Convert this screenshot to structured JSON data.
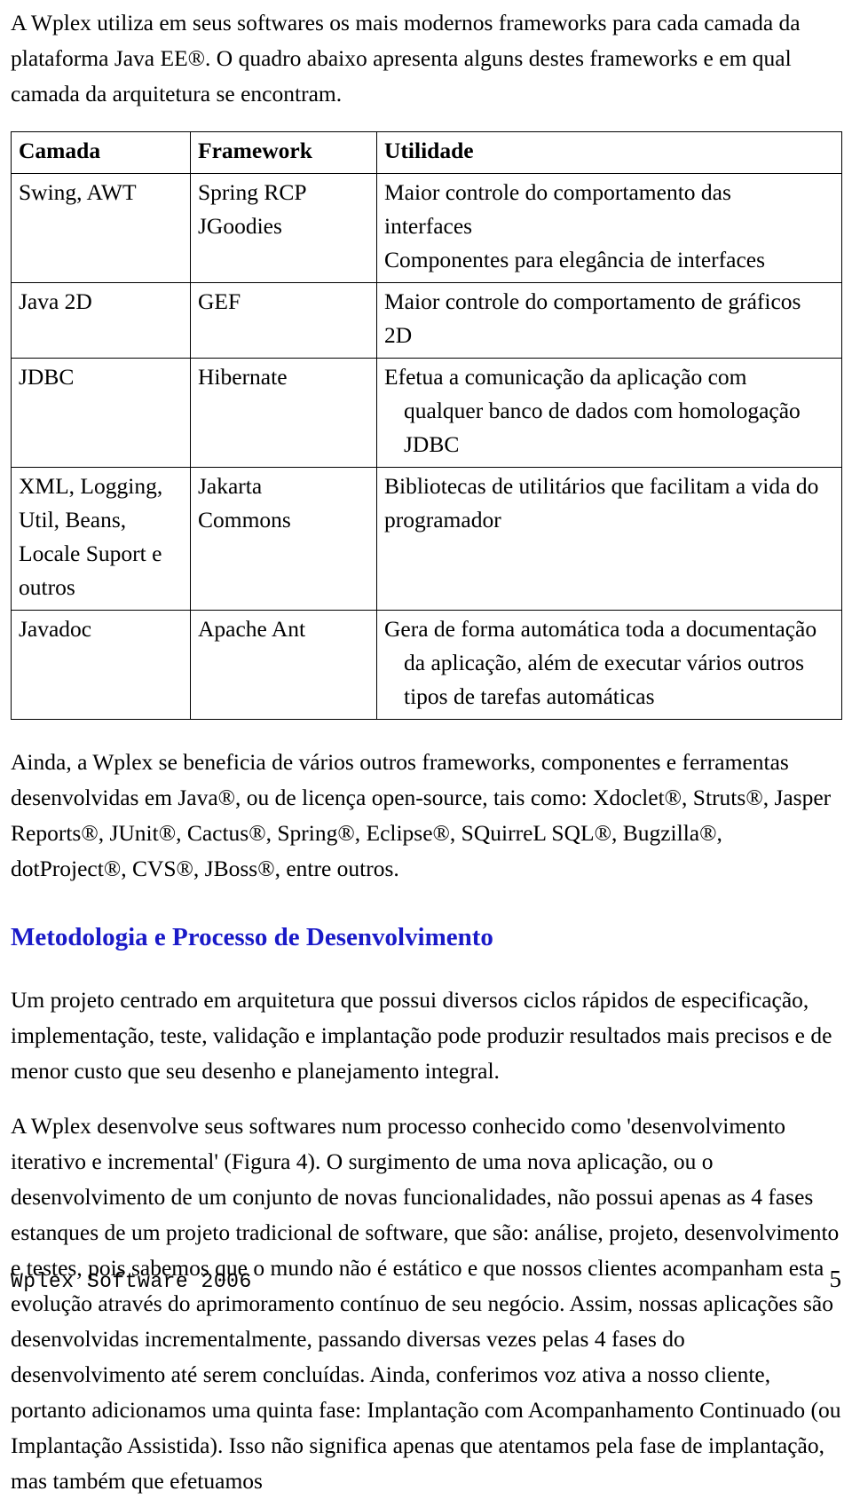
{
  "intro": {
    "paragraph": "A Wplex utiliza em seus softwares os mais modernos frameworks para cada camada da plataforma Java EE®. O quadro abaixo apresenta alguns destes frameworks e em qual camada da arquitetura se encontram."
  },
  "table": {
    "headers": {
      "col1": "Camada",
      "col2": "Framework",
      "col3": "Utilidade"
    },
    "rows": [
      {
        "camada": "Swing, AWT",
        "framework_lines": [
          "Spring RCP",
          "JGoodies"
        ],
        "utilidade_lines": [
          "Maior controle do comportamento das",
          "interfaces",
          "Componentes para elegância de interfaces"
        ],
        "utilidade_indent": [
          false,
          false,
          false
        ]
      },
      {
        "camada": "Java 2D",
        "framework_lines": [
          "GEF"
        ],
        "utilidade_lines": [
          "Maior controle do comportamento de gráficos",
          "2D"
        ],
        "utilidade_indent": [
          false,
          false
        ]
      },
      {
        "camada": "JDBC",
        "framework_lines": [
          "Hibernate"
        ],
        "utilidade_lines": [
          "Efetua a comunicação da aplicação com",
          "qualquer banco de dados com homologação",
          "JDBC"
        ],
        "utilidade_indent": [
          false,
          true,
          true
        ]
      },
      {
        "camada": "XML, Logging, Util, Beans, Locale Suport e outros",
        "framework_lines": [
          "Jakarta",
          "Commons"
        ],
        "utilidade_lines": [
          "Bibliotecas de utilitários que facilitam a vida do",
          "programador"
        ],
        "utilidade_indent": [
          false,
          false
        ]
      },
      {
        "camada": "Javadoc",
        "framework_lines": [
          "Apache Ant"
        ],
        "utilidade_lines": [
          "Gera de forma automática toda a documentação",
          "da aplicação, além de executar vários outros",
          "tipos de tarefas automáticas"
        ],
        "utilidade_indent": [
          false,
          true,
          true
        ]
      }
    ]
  },
  "after_table": {
    "paragraph": "Ainda, a Wplex se beneficia de vários outros frameworks, componentes e ferramentas desenvolvidas em Java®, ou de licença open-source, tais como: Xdoclet®, Struts®, Jasper Reports®, JUnit®, Cactus®, Spring®, Eclipse®, SQuirreL SQL®, Bugzilla®, dotProject®, CVS®, JBoss®, entre outros."
  },
  "section": {
    "heading": "Metodologia e Processo de Desenvolvimento",
    "heading_color": "#1a1ac8",
    "paragraph_1": "Um projeto centrado em arquitetura que possui diversos ciclos rápidos de especificação, implementação, teste, validação e implantação pode produzir resultados mais precisos e de menor custo que seu desenho e planejamento integral.",
    "paragraph_2": "A Wplex desenvolve seus softwares num processo conhecido como 'desenvolvimento iterativo e incremental' (Figura 4). O surgimento de uma nova aplicação, ou o desenvolvimento de um conjunto de novas funcionalidades, não possui apenas as 4 fases estanques de um projeto tradicional de software, que são: análise, projeto, desenvolvimento e testes, pois sabemos que o mundo não é estático e que nossos clientes acompanham esta evolução através do aprimoramento contínuo de seu negócio. Assim, nossas aplicações são desenvolvidas incrementalmente, passando diversas vezes pelas 4 fases do desenvolvimento até serem concluídas. Ainda, conferimos voz ativa a nosso cliente, portanto adicionamos uma quinta fase: Implantação com Acompanhamento Continuado (ou Implantação Assistida). Isso não significa apenas que atentamos pela fase de implantação, mas também que efetuamos"
  },
  "footer": {
    "left": "Wplex Software 2006",
    "page_number": "5"
  }
}
